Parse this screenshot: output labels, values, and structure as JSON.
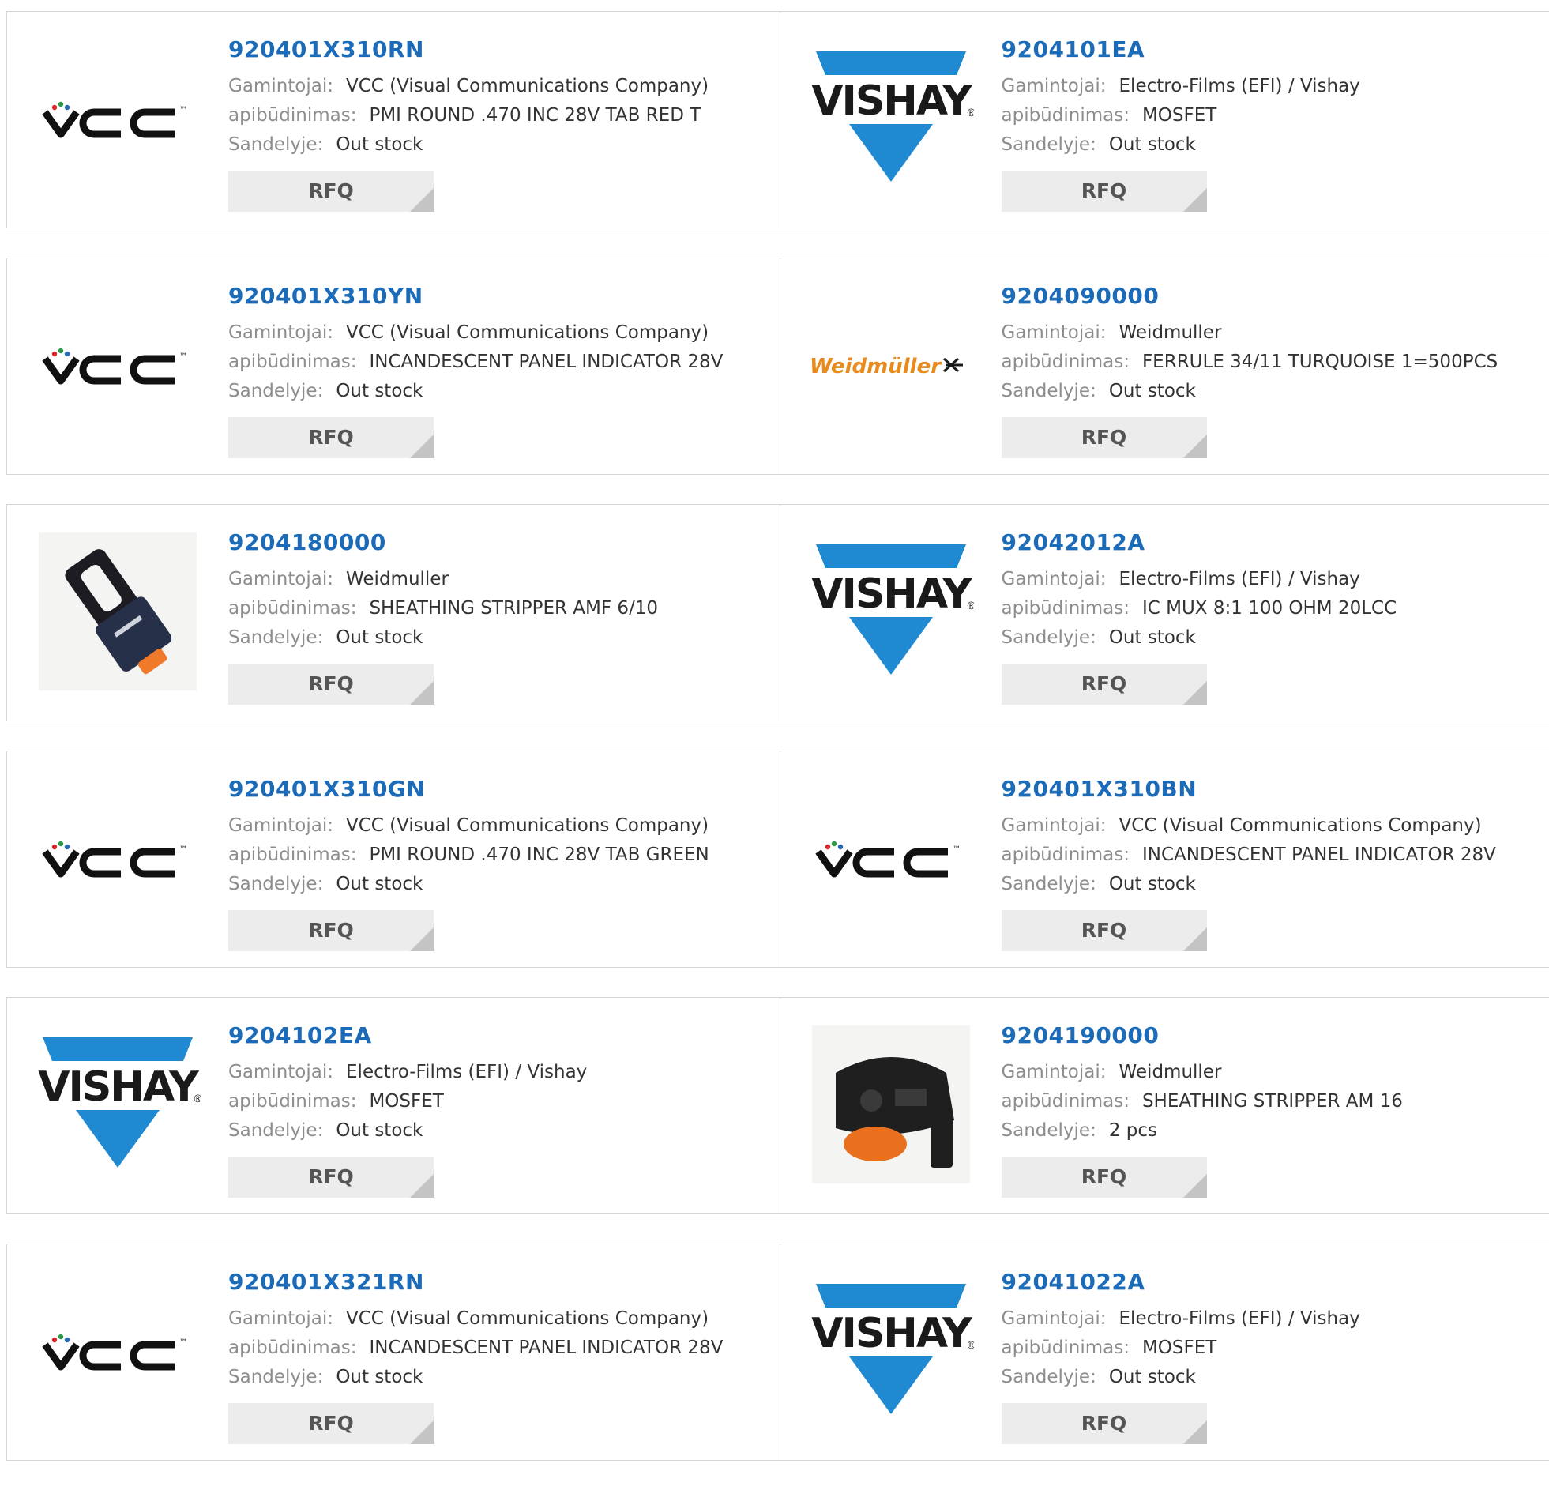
{
  "labels": {
    "manufacturer": "Gamintojai:",
    "description": "apibūdinimas:",
    "stock": "Sandelyje:",
    "rfq": "RFQ"
  },
  "brand_text": {
    "vcc": "VCC",
    "vcc_tm": "™",
    "vishay": "VISHAY",
    "vishay_mark": "®",
    "weidmuller": "Weidmüller"
  },
  "colors": {
    "part_link": "#1b6bb8",
    "vishay_blue": "#1f8ad1",
    "weidmuller_orange": "#e98b1c"
  },
  "products": [
    {
      "part": "920401X310RN",
      "logo": "vcc-logo",
      "manufacturer": "VCC (Visual Communications Company)",
      "description": "PMI ROUND .470 INC 28V TAB RED T",
      "stock": "Out stock"
    },
    {
      "part": "9204101EA",
      "logo": "vishay-logo",
      "manufacturer": "Electro-Films (EFI) / Vishay",
      "description": "MOSFET",
      "stock": "Out stock"
    },
    {
      "part": "920401X310YN",
      "logo": "vcc-logo",
      "manufacturer": "VCC (Visual Communications Company)",
      "description": "INCANDESCENT PANEL INDICATOR 28V",
      "stock": "Out stock"
    },
    {
      "part": "9204090000",
      "logo": "weidmuller-logo",
      "manufacturer": "Weidmuller",
      "description": "FERRULE 34/11 TURQUOISE 1=500PCS",
      "stock": "Out stock"
    },
    {
      "part": "9204180000",
      "logo": "stripper-photo",
      "manufacturer": "Weidmuller",
      "description": "SHEATHING STRIPPER AMF 6/10",
      "stock": "Out stock"
    },
    {
      "part": "92042012A",
      "logo": "vishay-logo",
      "manufacturer": "Electro-Films (EFI) / Vishay",
      "description": "IC MUX 8:1 100 OHM 20LCC",
      "stock": "Out stock"
    },
    {
      "part": "920401X310GN",
      "logo": "vcc-logo",
      "manufacturer": "VCC (Visual Communications Company)",
      "description": "PMI ROUND .470 INC 28V TAB GREEN",
      "stock": "Out stock"
    },
    {
      "part": "920401X310BN",
      "logo": "vcc-logo",
      "manufacturer": "VCC (Visual Communications Company)",
      "description": "INCANDESCENT PANEL INDICATOR 28V",
      "stock": "Out stock"
    },
    {
      "part": "9204102EA",
      "logo": "vishay-logo",
      "manufacturer": "Electro-Films (EFI) / Vishay",
      "description": "MOSFET",
      "stock": "Out stock"
    },
    {
      "part": "9204190000",
      "logo": "stripper-am16-photo",
      "manufacturer": "Weidmuller",
      "description": "SHEATHING STRIPPER AM 16",
      "stock": "2 pcs"
    },
    {
      "part": "920401X321RN",
      "logo": "vcc-logo",
      "manufacturer": "VCC (Visual Communications Company)",
      "description": "INCANDESCENT PANEL INDICATOR 28V",
      "stock": "Out stock"
    },
    {
      "part": "92041022A",
      "logo": "vishay-logo",
      "manufacturer": "Electro-Films (EFI) / Vishay",
      "description": "MOSFET",
      "stock": "Out stock"
    }
  ]
}
